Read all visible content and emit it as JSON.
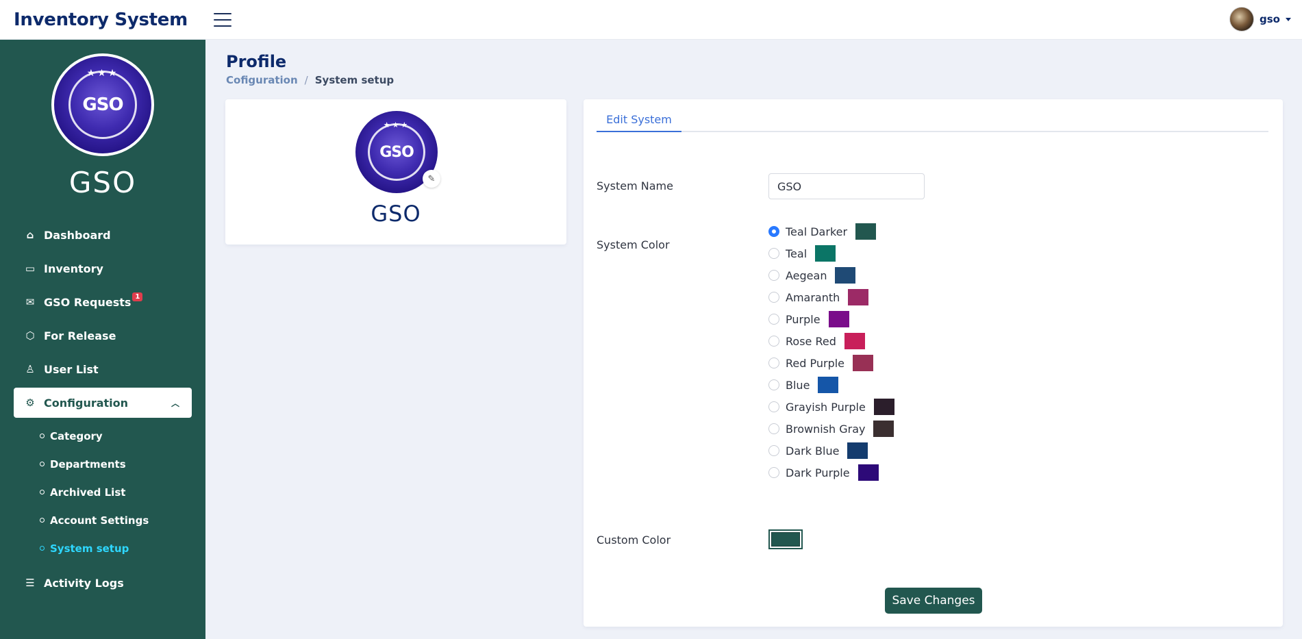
{
  "app": {
    "title": "Inventory System"
  },
  "user": {
    "name": "gso"
  },
  "sidebar": {
    "org_name": "GSO",
    "logo_text": "GSO",
    "items": [
      {
        "label": "Dashboard",
        "icon": "home-icon"
      },
      {
        "label": "Inventory",
        "icon": "archive-icon"
      },
      {
        "label": "GSO Requests",
        "icon": "inbox-icon",
        "badge": "1"
      },
      {
        "label": "For Release",
        "icon": "box-icon"
      },
      {
        "label": "User List",
        "icon": "user-icon"
      },
      {
        "label": "Configuration",
        "icon": "gear-icon"
      },
      {
        "label": "Activity Logs",
        "icon": "log-icon"
      }
    ],
    "sub_items": [
      "Category",
      "Departments",
      "Archived List",
      "Account Settings",
      "System setup"
    ]
  },
  "page": {
    "title": "Profile",
    "breadcrumb": {
      "parent": "Cofiguration",
      "separator": "/",
      "current": "System setup"
    }
  },
  "profile": {
    "name": "GSO",
    "logo_text": "GSO"
  },
  "edit": {
    "tab": "Edit System",
    "system_name_label": "System Name",
    "system_name_value": "GSO",
    "system_color_label": "System Color",
    "custom_color_label": "Custom Color",
    "custom_color_value": "#22574f",
    "save_label": "Save Changes",
    "colors": [
      {
        "name": "Teal Darker",
        "hex": "#22574f",
        "selected": true
      },
      {
        "name": "Teal",
        "hex": "#0b7566",
        "selected": false
      },
      {
        "name": "Aegean",
        "hex": "#1f4a75",
        "selected": false
      },
      {
        "name": "Amaranth",
        "hex": "#9c2a66",
        "selected": false
      },
      {
        "name": "Purple",
        "hex": "#7a0c8a",
        "selected": false
      },
      {
        "name": "Rose Red",
        "hex": "#c81f5a",
        "selected": false
      },
      {
        "name": "Red Purple",
        "hex": "#983055",
        "selected": false
      },
      {
        "name": "Blue",
        "hex": "#1556a8",
        "selected": false
      },
      {
        "name": "Grayish Purple",
        "hex": "#2b1e2b",
        "selected": false
      },
      {
        "name": "Brownish Gray",
        "hex": "#3b2f30",
        "selected": false
      },
      {
        "name": "Dark Blue",
        "hex": "#143c6e",
        "selected": false
      },
      {
        "name": "Dark Purple",
        "hex": "#2d0a78",
        "selected": false
      }
    ]
  }
}
